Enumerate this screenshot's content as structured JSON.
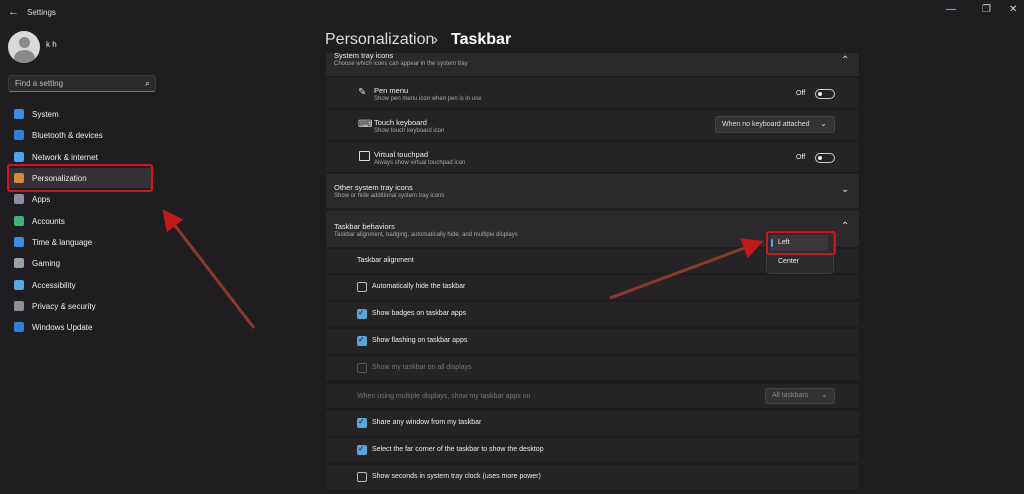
{
  "window": {
    "title": "Settings",
    "controls": [
      "—",
      "❐",
      "✕"
    ]
  },
  "user": {
    "name": "k h"
  },
  "search": {
    "placeholder": "Find a setting"
  },
  "sidebar": {
    "items": [
      {
        "label": "System",
        "icon": "system-icon",
        "color": "#3a8ee6"
      },
      {
        "label": "Bluetooth & devices",
        "icon": "bluetooth-icon",
        "color": "#2f7fd6"
      },
      {
        "label": "Network & internet",
        "icon": "wifi-icon",
        "color": "#4aa5ea"
      },
      {
        "label": "Personalization",
        "icon": "paintbrush-icon",
        "color": "#d38a3f"
      },
      {
        "label": "Apps",
        "icon": "apps-icon",
        "color": "#8b8fa5"
      },
      {
        "label": "Accounts",
        "icon": "accounts-icon",
        "color": "#3fb07d"
      },
      {
        "label": "Time & language",
        "icon": "globe-icon",
        "color": "#3a8ee6"
      },
      {
        "label": "Gaming",
        "icon": "gamepad-icon",
        "color": "#9aa0a6"
      },
      {
        "label": "Accessibility",
        "icon": "accessibility-icon",
        "color": "#5aa7e6"
      },
      {
        "label": "Privacy & security",
        "icon": "shield-icon",
        "color": "#8b8f96"
      },
      {
        "label": "Windows Update",
        "icon": "update-icon",
        "color": "#2f7fd6"
      }
    ],
    "active_index": 3
  },
  "breadcrumb": {
    "parent": "Personalization",
    "separator": "›",
    "current": "Taskbar"
  },
  "tray_section": {
    "title": "System tray icons",
    "desc": "Choose which icons can appear in the system tray",
    "items": [
      {
        "title": "Pen menu",
        "desc": "Show pen menu icon when pen is in use",
        "control": "toggle",
        "value": "Off",
        "icon": "pen-icon"
      },
      {
        "title": "Touch keyboard",
        "desc": "Show touch keyboard icon",
        "control": "dropdown",
        "value": "When no keyboard attached",
        "icon": "keyboard-icon"
      },
      {
        "title": "Virtual touchpad",
        "desc": "Always show virtual touchpad icon",
        "control": "toggle",
        "value": "Off",
        "icon": "touchpad-icon"
      }
    ]
  },
  "other_tray": {
    "title": "Other system tray icons",
    "desc": "Show or hide additional system tray icons"
  },
  "behaviors": {
    "title": "Taskbar behaviors",
    "desc": "Taskbar alignment, badging, automatically hide, and multiple displays",
    "alignment_label": "Taskbar alignment",
    "alignment_options": [
      "Left",
      "Center"
    ],
    "selected_alignment": "Left",
    "options": [
      {
        "label": "Automatically hide the taskbar",
        "checked": false,
        "disabled": false
      },
      {
        "label": "Show badges on taskbar apps",
        "checked": true,
        "disabled": false
      },
      {
        "label": "Show flashing on taskbar apps",
        "checked": true,
        "disabled": false
      },
      {
        "label": "Show my taskbar on all displays",
        "checked": false,
        "disabled": true
      }
    ],
    "multi_display_label": "When using multiple displays, show my taskbar apps on",
    "multi_display_value": "All taskbars",
    "options2": [
      {
        "label": "Share any window from my taskbar",
        "checked": true,
        "disabled": false
      },
      {
        "label": "Select the far corner of the taskbar to show the desktop",
        "checked": true,
        "disabled": false
      },
      {
        "label": "Show seconds in system tray clock (uses more power)",
        "checked": false,
        "disabled": false
      }
    ]
  },
  "annotations": {
    "highlight_color": "#d0161b",
    "arrow_color": "#c01a1a"
  }
}
